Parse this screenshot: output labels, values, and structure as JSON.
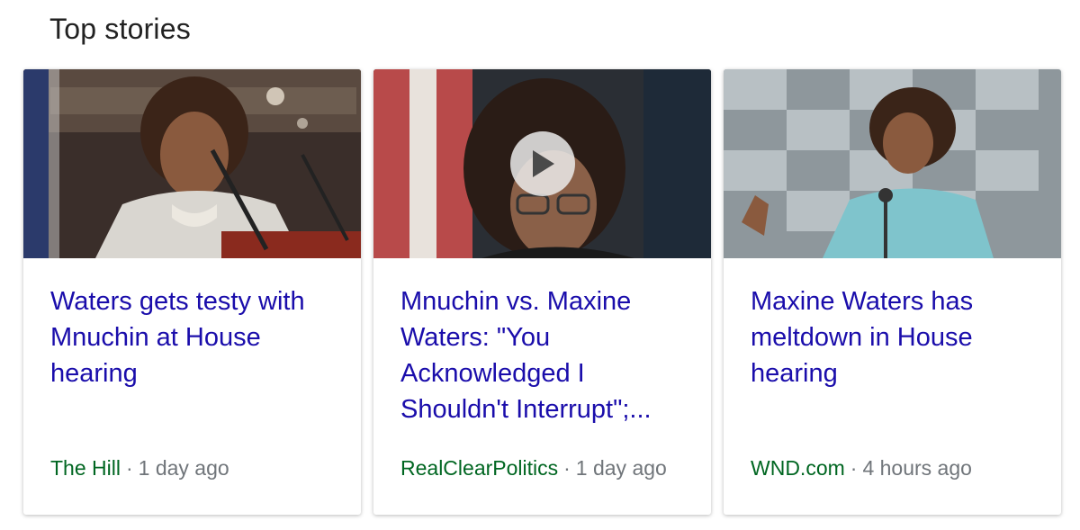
{
  "section": {
    "title": "Top stories"
  },
  "stories": [
    {
      "headline": "Waters gets testy with Mnuchin at House hearing",
      "source": "The Hill",
      "separator": "·",
      "age": "1 day ago",
      "has_video": false
    },
    {
      "headline": "Mnuchin vs. Maxine Waters: \"You Acknowledged I Shouldn't Interrupt\";...",
      "source": "RealClearPolitics",
      "separator": "·",
      "age": "1 day ago",
      "has_video": true
    },
    {
      "headline": "Maxine Waters has meltdown in House hearing",
      "source": "WND.com",
      "separator": "·",
      "age": "4 hours ago",
      "has_video": false
    }
  ],
  "colors": {
    "link": "#1a0dab",
    "source": "#006621",
    "meta": "#70757a",
    "title": "#222222"
  },
  "icons": {
    "play": "play-icon"
  }
}
